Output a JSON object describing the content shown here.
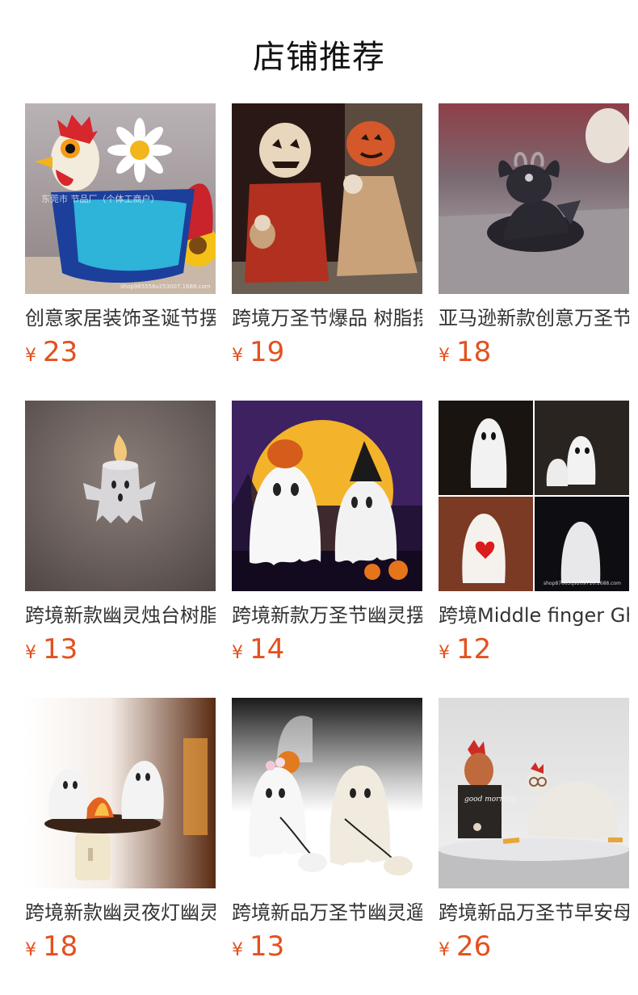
{
  "header": {
    "title": "店铺推荐"
  },
  "products": [
    {
      "name": "创意家居装饰圣诞节摆件",
      "currency": "¥",
      "price": "23",
      "image": "rooster-planter",
      "watermark": "东莞市 节品厂（个体工商户）",
      "shop_watermark": "shop965556v253007.1688.com"
    },
    {
      "name": "跨境万圣节爆品 树脂摆件",
      "currency": "¥",
      "price": "19",
      "image": "pumpkin-scarecrows"
    },
    {
      "name": "亚马逊新款创意万圣节",
      "currency": "¥",
      "price": "18",
      "image": "black-goat-dragon"
    },
    {
      "name": "跨境新款幽灵烛台树脂",
      "currency": "¥",
      "price": "13",
      "image": "ghost-candle-holder"
    },
    {
      "name": "跨境新款万圣节幽灵摆件",
      "currency": "¥",
      "price": "14",
      "image": "ghosts-moon-night"
    },
    {
      "name": "跨境Middle finger Ghost",
      "currency": "¥",
      "price": "12",
      "image": "ghost-collage",
      "shop_watermark": "shop87665q9209710.1688.com"
    },
    {
      "name": "跨境新款幽灵夜灯幽灵",
      "currency": "¥",
      "price": "18",
      "image": "ghost-campfire-nightlight"
    },
    {
      "name": "跨境新品万圣节幽灵遛狗",
      "currency": "¥",
      "price": "13",
      "image": "ghosts-walking-dogs"
    },
    {
      "name": "跨境新品万圣节早安母鸡",
      "currency": "¥",
      "price": "26",
      "image": "good-morning-chickens",
      "sign_text": "good morning"
    }
  ]
}
